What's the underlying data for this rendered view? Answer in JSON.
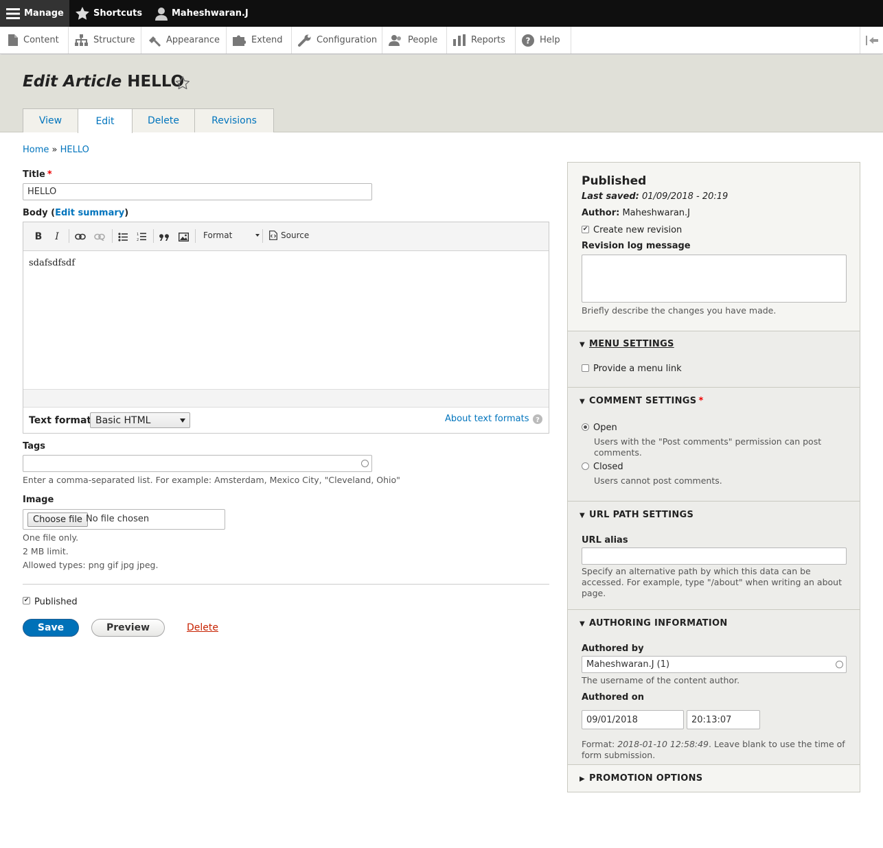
{
  "toolbar": {
    "manage": "Manage",
    "shortcuts": "Shortcuts",
    "user": "Maheshwaran.J"
  },
  "tray": {
    "items": [
      "Content",
      "Structure",
      "Appearance",
      "Extend",
      "Configuration",
      "People",
      "Reports",
      "Help"
    ]
  },
  "header": {
    "title_type": "Edit Article",
    "title_name": "HELLO",
    "tabs": [
      "View",
      "Edit",
      "Delete",
      "Revisions"
    ]
  },
  "breadcrumb": {
    "home": "Home",
    "sep": "»",
    "current": "HELLO"
  },
  "form": {
    "title_label": "Title",
    "required_mark": "*",
    "title_value": "HELLO",
    "body_label": "Body",
    "body_paren_open": "(",
    "edit_summary": "Edit summary",
    "body_paren_close": ")",
    "editor_format": "Format",
    "editor_source": "Source",
    "editor_content": "sdafsdfsdf",
    "text_format_label": "Text format",
    "text_format_value": "Basic HTML",
    "about_text_formats": "About text formats",
    "tags_label": "Tags",
    "tags_help": "Enter a comma-separated list. For example: Amsterdam, Mexico City, \"Cleveland, Ohio\"",
    "image_label": "Image",
    "choose_file": "Choose file",
    "no_file": "No file chosen",
    "image_help": [
      "One file only.",
      "2 MB limit.",
      "Allowed types: png gif jpg jpeg."
    ],
    "published_label": "Published",
    "save": "Save",
    "preview": "Preview",
    "delete": "Delete"
  },
  "sidebar": {
    "status": "Published",
    "last_saved_label": "Last saved:",
    "last_saved_value": "01/09/2018 - 20:19",
    "author_label": "Author:",
    "author_value": "Maheshwaran.J",
    "create_revision": "Create new revision",
    "revision_log_label": "Revision log message",
    "revision_log_help": "Briefly describe the changes you have made.",
    "menu_settings": "MENU SETTINGS",
    "provide_menu_link": "Provide a menu link",
    "comment_settings": "COMMENT SETTINGS",
    "comment_open": "Open",
    "comment_open_help": "Users with the \"Post comments\" permission can post comments.",
    "comment_closed": "Closed",
    "comment_closed_help": "Users cannot post comments.",
    "url_path_settings": "URL PATH SETTINGS",
    "url_alias_label": "URL alias",
    "url_alias_help": "Specify an alternative path by which this data can be accessed. For example, type \"/about\" when writing an about page.",
    "authoring_information": "AUTHORING INFORMATION",
    "authored_by_label": "Authored by",
    "authored_by_value": "Maheshwaran.J (1)",
    "authored_by_help": "The username of the content author.",
    "authored_on_label": "Authored on",
    "authored_on_date": "09/01/2018",
    "authored_on_time": "20:13:07",
    "format_prefix": "Format:",
    "format_example": "2018-01-10 12:58:49",
    "format_suffix": ". Leave blank to use the time of form submission.",
    "promotion_options": "PROMOTION OPTIONS"
  },
  "colors": {
    "link": "#0074bd",
    "primary_button": "#0071b8",
    "toolbar": "#0f0f0f",
    "header_bg": "#e0e0d8",
    "required": "#e00000",
    "danger": "#c72100"
  }
}
